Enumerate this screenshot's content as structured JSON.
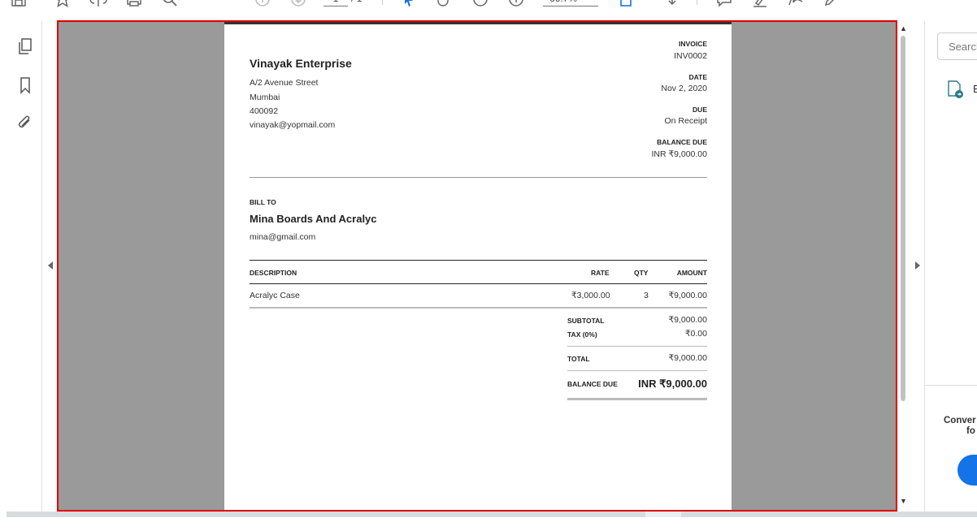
{
  "toolbar": {
    "icons": [
      "save-icon",
      "star-icon",
      "upload-icon",
      "print-icon",
      "search-icon",
      "prev-page-icon",
      "next-page-icon",
      "select-icon",
      "hand-icon",
      "zoom-out-icon",
      "zoom-in-icon",
      "fit-page-icon",
      "scroll-mode-icon",
      "comment-icon",
      "highlight-icon",
      "sign-icon",
      "edit-icon"
    ],
    "page_current": "1",
    "page_total": "/ 1",
    "zoom": "66.7%"
  },
  "left_rail": {
    "icons": [
      "pages-icon",
      "bookmark-icon",
      "attachment-icon"
    ]
  },
  "invoice": {
    "company": {
      "name": "Vinayak Enterprise",
      "address1": "A/2 Avenue Street",
      "city": "Mumbai",
      "zip": "400092",
      "email": "vinayak@yopmail.com"
    },
    "meta": {
      "invoice_label": "INVOICE",
      "invoice_number": "INV0002",
      "date_label": "DATE",
      "date_value": "Nov 2, 2020",
      "due_label": "DUE",
      "due_value": "On Receipt",
      "balance_label": "BALANCE DUE",
      "balance_value": "INR ₹9,000.00"
    },
    "bill_to": {
      "label": "BILL TO",
      "name": "Mina Boards And Acralyc",
      "email": "mina@gmail.com"
    },
    "table": {
      "headers": {
        "description": "DESCRIPTION",
        "rate": "RATE",
        "qty": "QTY",
        "amount": "AMOUNT"
      },
      "rows": [
        {
          "description": "Acralyc Case",
          "rate": "₹3,000.00",
          "qty": "3",
          "amount": "₹9,000.00"
        }
      ]
    },
    "summary": {
      "subtotal_label": "SUBTOTAL",
      "subtotal_value": "₹9,000.00",
      "tax_label": "TAX (0%)",
      "tax_value": "₹0.00",
      "total_label": "TOTAL",
      "total_value": "₹9,000.00",
      "balance_due_label": "BALANCE DUE",
      "balance_due_value": "INR ₹9,000.00"
    }
  },
  "right_pane": {
    "search_placeholder": "Search",
    "tool_label": "E",
    "promo_line1": "Conver",
    "promo_line2": "fo"
  }
}
